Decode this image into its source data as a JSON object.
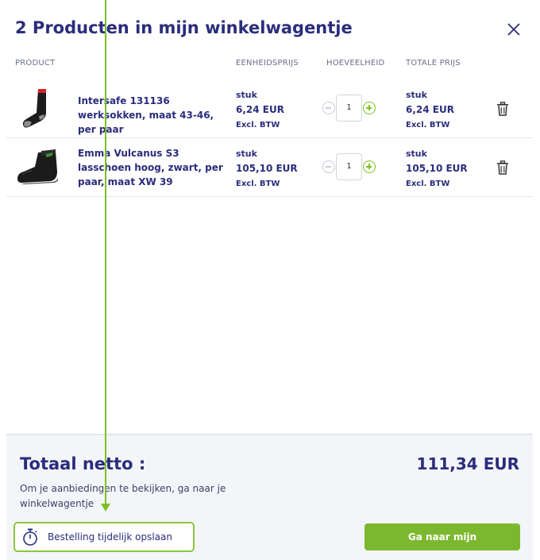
{
  "header": {
    "title": "2 Producten in mijn winkelwagentje",
    "close_icon": "close-icon"
  },
  "columns": {
    "product": "PRODUCT",
    "unit_price": "EENHEIDSPRIJS",
    "quantity": "HOEVEELHEID",
    "total_price": "TOTALE PRIJS"
  },
  "items": [
    {
      "name": "Intersafe 131136 werksokken, maat 43-46, per paar",
      "unit_price": {
        "unit": "stuk",
        "amount": "6,24 EUR",
        "tax": "Excl. BTW"
      },
      "quantity": "1",
      "total_price": {
        "unit": "stuk",
        "amount": "6,24 EUR",
        "tax": "Excl. BTW"
      },
      "thumb_icon": "sock-image"
    },
    {
      "name": "Emma Vulcanus S3 lasschoen hoog, zwart, per paar, maat XW 39",
      "unit_price": {
        "unit": "stuk",
        "amount": "105,10 EUR",
        "tax": "Excl. BTW"
      },
      "quantity": "1",
      "total_price": {
        "unit": "stuk",
        "amount": "105,10 EUR",
        "tax": "Excl. BTW"
      },
      "thumb_icon": "boot-image"
    }
  ],
  "footer": {
    "total_label": "Totaal netto :",
    "total_value": "111,34 EUR",
    "note": "Om je aanbiedingen te bekijken, ga naar je winkelwagentje",
    "save_label": "Bestelling tijdelijk opslaan",
    "save_icon": "stopwatch-icon",
    "go_label": "Ga naar mijn winkelwagentje"
  },
  "colors": {
    "brand_navy": "#2a2d7c",
    "accent_green": "#7cb82f",
    "footer_bg": "#f4f5f8"
  }
}
